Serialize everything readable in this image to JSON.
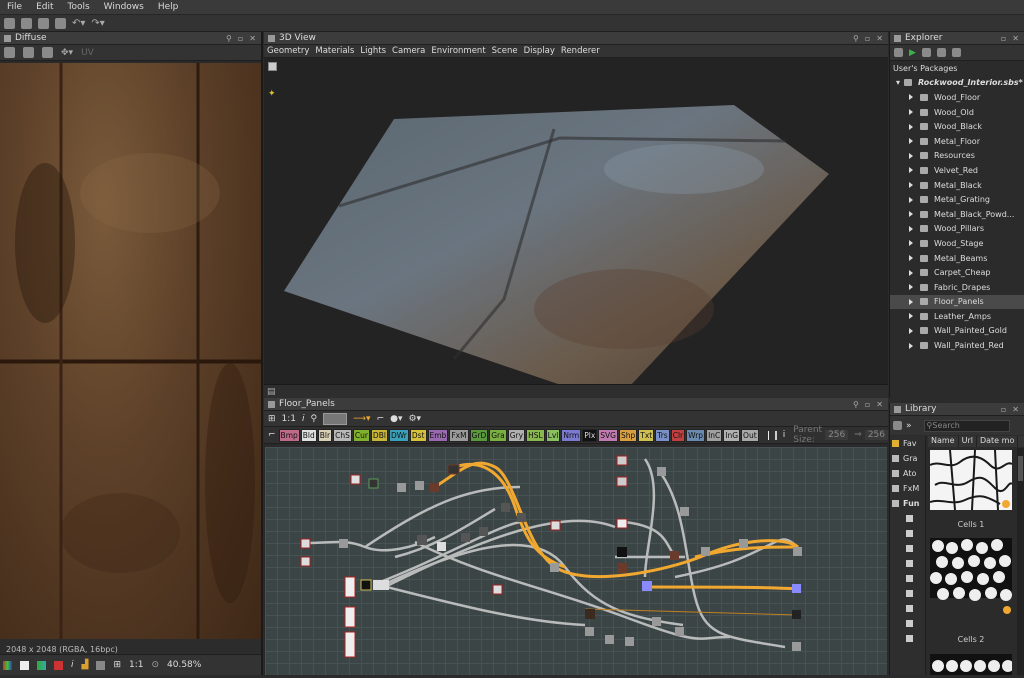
{
  "menu": [
    "File",
    "Edit",
    "Tools",
    "Windows",
    "Help"
  ],
  "diffuse": {
    "title": "Diffuse",
    "uv_label": "UV",
    "image_info": "2048 x 2048 (RGBA, 16bpc)",
    "ratio": "1:1",
    "zoom": "40.58%"
  },
  "view3d": {
    "title": "3D View",
    "menu": [
      "Geometry",
      "Materials",
      "Lights",
      "Camera",
      "Environment",
      "Scene",
      "Display",
      "Renderer"
    ]
  },
  "graph": {
    "title": "Floor_Panels",
    "ratio": "1:1",
    "info": "i",
    "parent_size_label": "Parent Size:",
    "parent_size_value": "256",
    "size_value": "256",
    "nodes": [
      {
        "label": "Bmp",
        "color": "#c06a8a"
      },
      {
        "label": "Bld",
        "color": "#e0e0e0"
      },
      {
        "label": "Blr",
        "color": "#d9d0b8"
      },
      {
        "label": "ChS",
        "color": "#b8b8b8"
      },
      {
        "label": "Cur",
        "color": "#7fb02e"
      },
      {
        "label": "DBl",
        "color": "#c8b63a"
      },
      {
        "label": "DWr",
        "color": "#3aa0b8"
      },
      {
        "label": "Dst",
        "color": "#d6c23a"
      },
      {
        "label": "Emb",
        "color": "#9a6ab0"
      },
      {
        "label": "FxM",
        "color": "#9a9a9a"
      },
      {
        "label": "GrD",
        "color": "#5a9a3a"
      },
      {
        "label": "Gra",
        "color": "#7ab040"
      },
      {
        "label": "Gry",
        "color": "#b0b0b0"
      },
      {
        "label": "HSL",
        "color": "#8ab850"
      },
      {
        "label": "Lvl",
        "color": "#8ac060"
      },
      {
        "label": "Nrm",
        "color": "#7a7ad0"
      },
      {
        "label": "Plx",
        "color": "#111111"
      },
      {
        "label": "SVG",
        "color": "#c07ab0"
      },
      {
        "label": "Shp",
        "color": "#d8a040"
      },
      {
        "label": "Txt",
        "color": "#d0c050"
      },
      {
        "label": "Trs",
        "color": "#7a90c8"
      },
      {
        "label": "Clr",
        "color": "#c04040"
      },
      {
        "label": "Wrp",
        "color": "#6a8ab0"
      },
      {
        "label": "InC",
        "color": "#a0a0a0"
      },
      {
        "label": "InG",
        "color": "#b0b0b0"
      },
      {
        "label": "Out",
        "color": "#a8a8a8"
      }
    ]
  },
  "explorer": {
    "title": "Explorer",
    "section": "User's Packages",
    "package": "Rockwood_Interior.sbs*",
    "items": [
      "Wood_Floor",
      "Wood_Old",
      "Wood_Black",
      "Metal_Floor",
      "Resources",
      "Velvet_Red",
      "Metal_Black",
      "Metal_Grating",
      "Metal_Black_Powd...",
      "Wood_Pillars",
      "Wood_Stage",
      "Metal_Beams",
      "Carpet_Cheap",
      "Fabric_Drapes",
      "Floor_Panels",
      "Leather_Amps",
      "Wall_Painted_Gold",
      "Wall_Painted_Red"
    ],
    "selected": "Floor_Panels"
  },
  "library": {
    "title": "Library",
    "search_placeholder": "Search",
    "columns": [
      "Name",
      "Url",
      "Date mo"
    ],
    "categories": [
      "Fav",
      "Gra",
      "Ato",
      "FxM",
      "Fun"
    ],
    "thumbs": [
      "Cells 1",
      "Cells 2"
    ]
  },
  "colors": {
    "accent": "#f0a830",
    "selection": "#4a4a4a",
    "graph_bg": "#3b4546"
  }
}
